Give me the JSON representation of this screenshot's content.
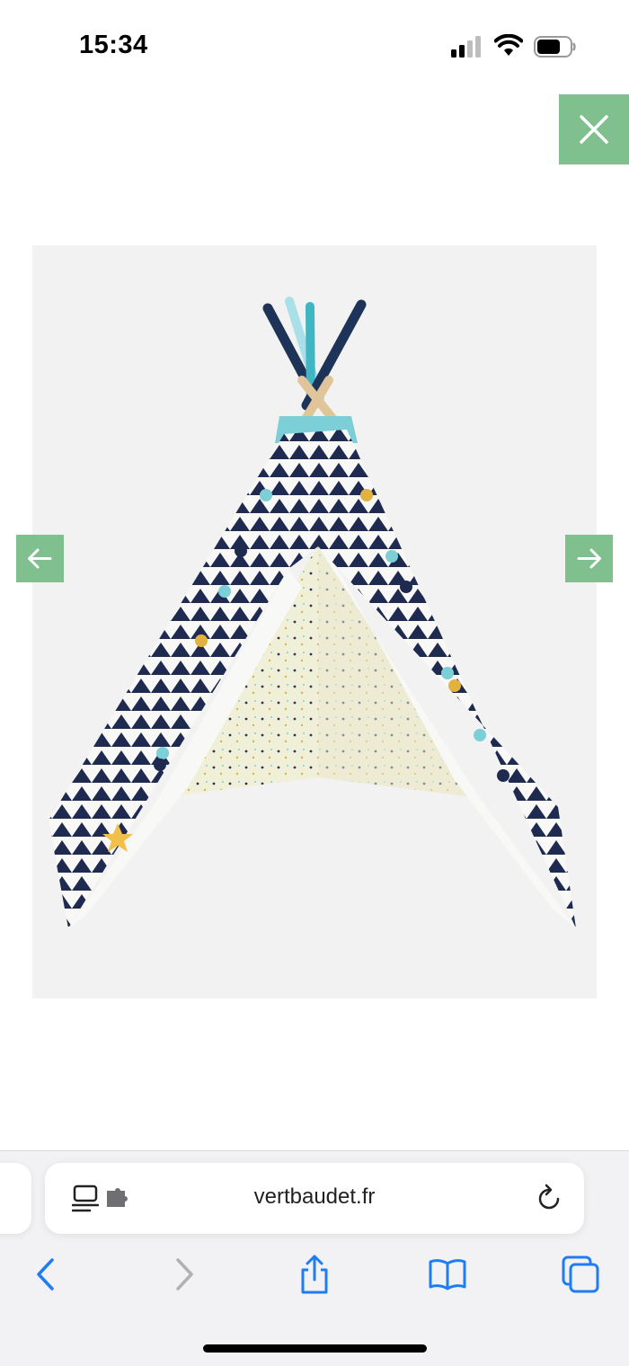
{
  "status_bar": {
    "time": "15:34",
    "signal_icon": "cellular-signal-icon",
    "wifi_icon": "wifi-icon",
    "battery_icon": "battery-icon"
  },
  "gallery": {
    "close_icon": "close-icon",
    "prev_icon": "arrow-left-icon",
    "next_icon": "arrow-right-icon",
    "accent_color": "#7fc08e",
    "image_subject": "children's teepee tent with navy triangle print and pompoms"
  },
  "browser": {
    "url": "vertbaudet.fr",
    "reader_icon": "reader-mode-icon",
    "extension_icon": "extension-puzzle-icon",
    "reload_icon": "reload-icon",
    "toolbar": {
      "back_icon": "chevron-left-icon",
      "forward_icon": "chevron-right-icon",
      "share_icon": "share-icon",
      "bookmarks_icon": "book-icon",
      "tabs_icon": "tabs-icon"
    },
    "tint_color": "#1f7cf2"
  }
}
